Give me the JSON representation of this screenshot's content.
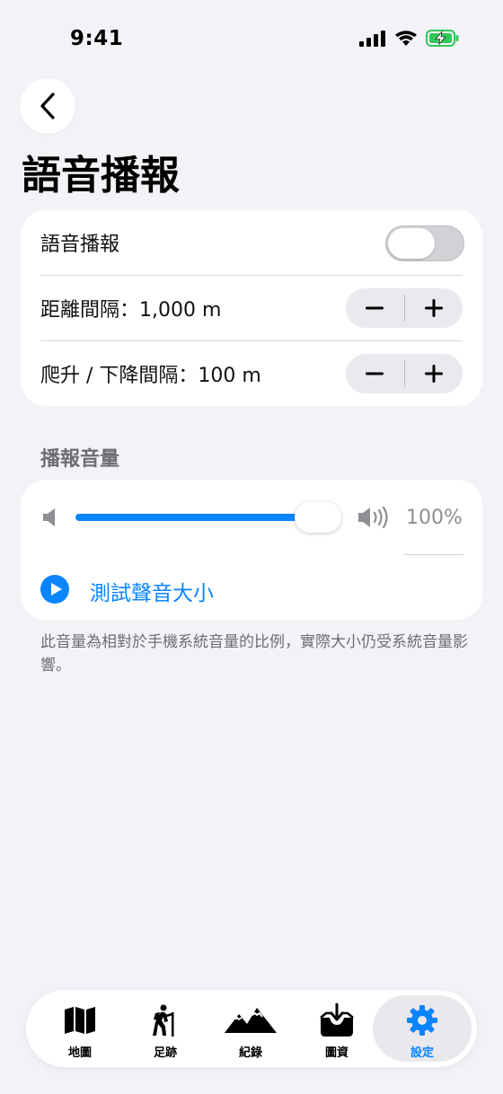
{
  "status_bar": {
    "time": "9:41"
  },
  "page": {
    "title": "語音播報"
  },
  "announce_card": {
    "toggle_label": "語音播報",
    "toggle_on": false,
    "distance_label": "距離間隔：1,000 m",
    "elevation_label": "爬升 / 下降間隔：100 m",
    "minus_icon": "minus-icon",
    "plus_icon": "plus-icon"
  },
  "volume_section": {
    "header": "播報音量",
    "volume_fraction": 1.0,
    "volume_text": "100%",
    "test_label": "測試聲音大小",
    "footnote": "此音量為相對於手機系統音量的比例，實際大小仍受系統音量影響。"
  },
  "tabbar": {
    "tabs": [
      {
        "label": "地圖",
        "icon": "map-icon"
      },
      {
        "label": "足跡",
        "icon": "hiker-icon"
      },
      {
        "label": "紀錄",
        "icon": "mountain-icon"
      },
      {
        "label": "圖資",
        "icon": "download-tray-icon"
      },
      {
        "label": "設定",
        "icon": "gear-icon",
        "active": true
      }
    ]
  },
  "colors": {
    "accent": "#0a84ff",
    "background": "#f2f2f7"
  }
}
